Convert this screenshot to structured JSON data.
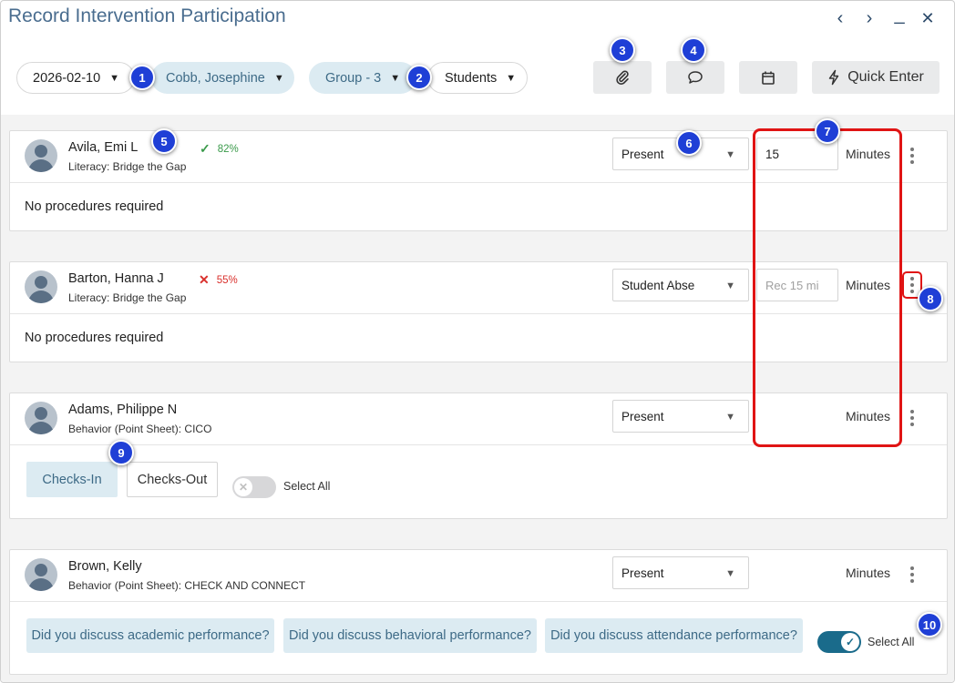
{
  "window": {
    "title": "Record Intervention Participation",
    "controls": {
      "prev": "‹",
      "next": "›",
      "minimize": "_",
      "close": "✕"
    }
  },
  "toolbar": {
    "date": "2026-02-10",
    "teacher": "Cobb, Josephine",
    "group": "Group - 3",
    "view": "Students",
    "quick_enter": "Quick Enter"
  },
  "badges": [
    "1",
    "2",
    "3",
    "4",
    "5",
    "6",
    "7",
    "8",
    "9",
    "10"
  ],
  "students": [
    {
      "name": "Avila, Emi L",
      "program": "Literacy: Bridge the Gap",
      "pct": "82%",
      "pct_status": "good",
      "attendance": "Present",
      "minutes_value": "15",
      "minutes_placeholder": "",
      "minutes_label": "Minutes",
      "note": "No procedures required"
    },
    {
      "name": "Barton, Hanna J",
      "program": "Literacy: Bridge the Gap",
      "pct": "55%",
      "pct_status": "bad",
      "attendance": "Student Absent",
      "minutes_value": "",
      "minutes_placeholder": "Rec 15 mi",
      "minutes_label": "Minutes",
      "note": "No procedures required"
    },
    {
      "name": "Adams, Philippe N",
      "program": "Behavior (Point Sheet): CICO",
      "attendance": "Present",
      "minutes_label": "Minutes",
      "checks_in": "Checks-In",
      "checks_out": "Checks-Out",
      "select_all": "Select All",
      "select_all_on": false
    },
    {
      "name": "Brown, Kelly",
      "program": "Behavior (Point Sheet): CHECK AND CONNECT",
      "attendance": "Present",
      "minutes_label": "Minutes",
      "questions": [
        "Did you discuss academic performance?",
        "Did you discuss behavioral performance?",
        "Did you discuss attendance performance?"
      ],
      "select_all": "Select All",
      "select_all_on": true
    }
  ],
  "colors": {
    "title": "#4a6d8f",
    "accent_fill": "#dcebf2",
    "accent_text": "#3d6a86",
    "badge": "#1f3fd6",
    "highlight": "#e01414",
    "toggle_on": "#1a6b8b",
    "good": "#3a9a4a",
    "bad": "#d9302c"
  },
  "icons": {
    "attach": "paperclip-icon",
    "comment": "speech-bubble-icon",
    "calendar": "calendar-icon",
    "quick_enter": "lightning-icon",
    "caret": "caret-down-icon",
    "more": "kebab-menu-icon",
    "avatar": "user-avatar-icon"
  }
}
